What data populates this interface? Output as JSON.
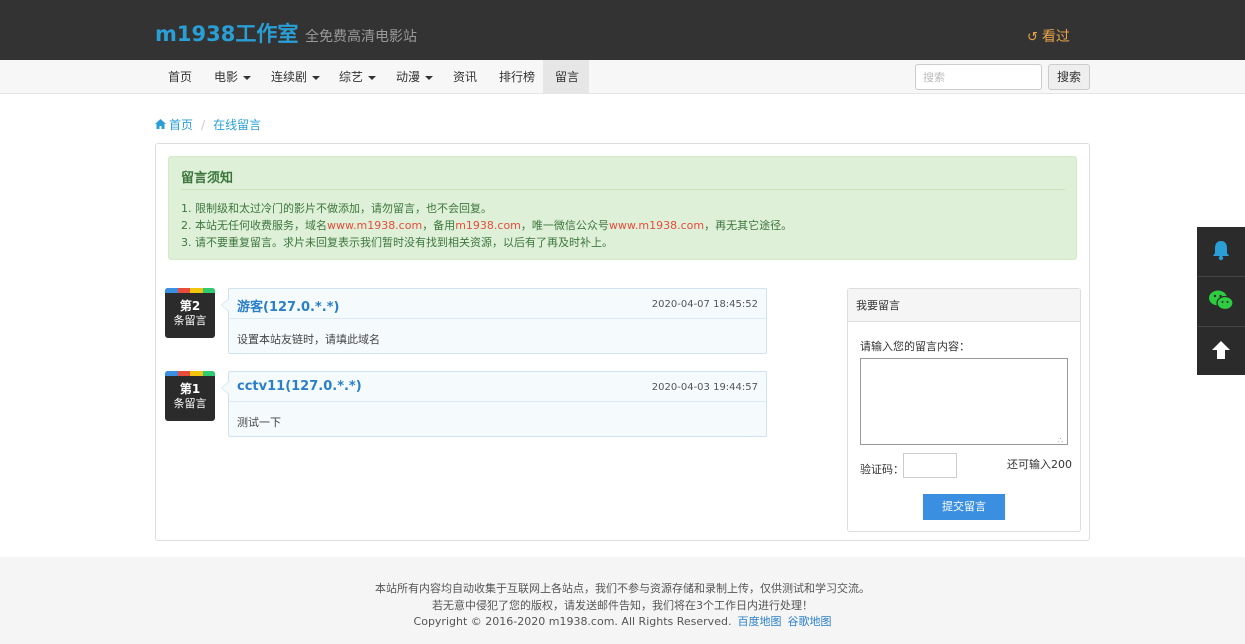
{
  "header": {
    "logo": "m1938工作室",
    "slogan": "全免费高清电影站",
    "history_label": "看过"
  },
  "nav": {
    "items": [
      {
        "label": "首页",
        "dropdown": false
      },
      {
        "label": "电影",
        "dropdown": true
      },
      {
        "label": "连续剧",
        "dropdown": true
      },
      {
        "label": "综艺",
        "dropdown": true
      },
      {
        "label": "动漫",
        "dropdown": true
      },
      {
        "label": "资讯",
        "dropdown": false
      },
      {
        "label": "排行榜",
        "dropdown": false
      },
      {
        "label": "留言",
        "dropdown": false,
        "active": true
      }
    ],
    "search_placeholder": "搜索",
    "search_button": "搜索"
  },
  "breadcrumb": {
    "home": "首页",
    "separator": "/",
    "current": "在线留言"
  },
  "notice": {
    "title": "留言须知",
    "line1": "1. 限制级和太过冷门的影片不做添加，请勿留言，也不会回复。",
    "line2_a": "2. 本站无任何收费服务，域名",
    "line2_domain1": "www.m1938.com",
    "line2_b": "，备用",
    "line2_domain2": "m1938.com",
    "line2_c": "，唯一微信公众号",
    "line2_domain3": "www.m1938.com",
    "line2_d": "，再无其它途径。",
    "line3": "3. 请不要重复留言。求片未回复表示我们暂时没有找到相关资源，以后有了再及时补上。"
  },
  "messages": [
    {
      "floor_top": "第2",
      "floor_bottom": "条留言",
      "user": "游客(127.0.*.*)",
      "time": "2020-04-07 18:45:52",
      "content": "设置本站友链时，请填此域名"
    },
    {
      "floor_top": "第1",
      "floor_bottom": "条留言",
      "user": "cctv11(127.0.*.*)",
      "time": "2020-04-03 19:44:57",
      "content": "测试一下"
    }
  ],
  "form": {
    "title": "我要留言",
    "content_label": "请输入您的留言内容：",
    "code_label": "验证码：",
    "remain": "还可输入200",
    "submit": "提交留言"
  },
  "footer": {
    "line1": "本站所有内容均自动收集于互联网上各站点，我们不参与资源存储和录制上传，仅供测试和学习交流。",
    "line2": "若无意中侵犯了您的版权，请发送邮件告知，我们将在3个工作日内进行处理！",
    "copyright": "Copyright © 2016-2020 m1938.com. All Rights Reserved.",
    "link_baidu": "百度地图",
    "link_google": "谷歌地图"
  },
  "colors": {
    "brand": "#2a9fd6",
    "topbar": "#333333",
    "notice_bg": "#dff0d8",
    "notice_text": "#3c763d",
    "submit": "#3b8fe0",
    "history": "#e8a34a"
  },
  "icons": [
    "history-icon",
    "home-icon",
    "bell-icon",
    "wechat-icon",
    "arrow-up-icon"
  ]
}
